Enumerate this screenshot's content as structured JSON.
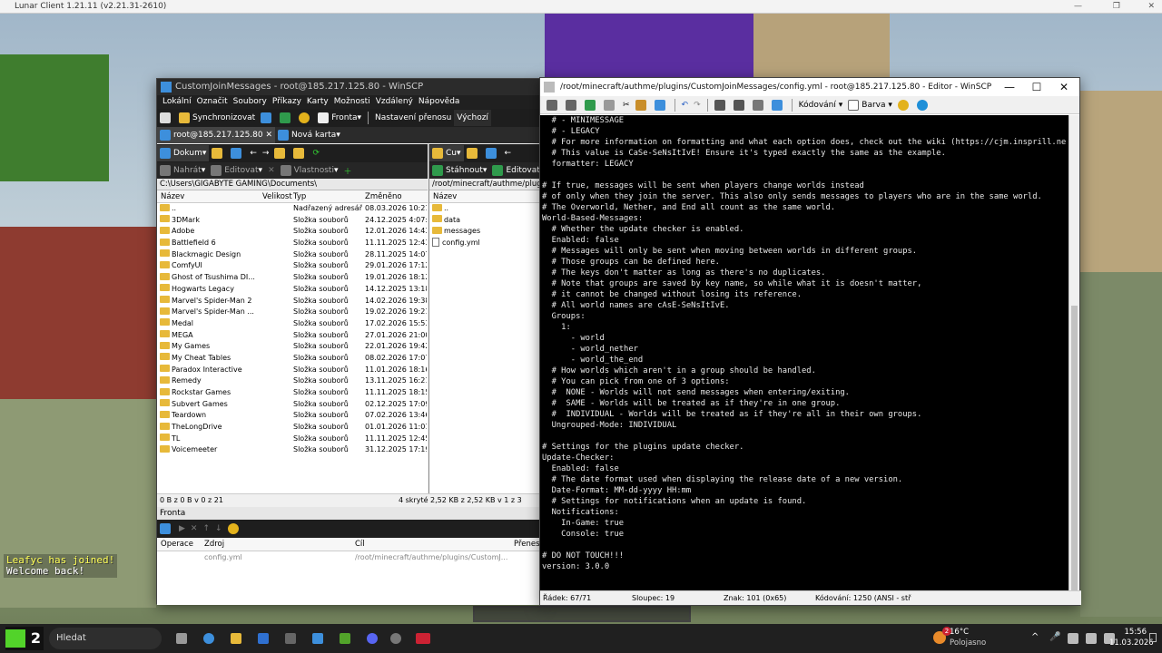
{
  "lunar": {
    "title": "Lunar Client 1.21.11 (v2.21.31-2610)"
  },
  "chat": {
    "player": "Leafyc",
    "joined": " has joined!",
    "welcome": "Welcome back!"
  },
  "winscp": {
    "title": "CustomJoinMessages - root@185.217.125.80 - WinSCP",
    "menu": [
      "Lokální",
      "Označit",
      "Soubory",
      "Příkazy",
      "Karty",
      "Možnosti",
      "Vzdálený",
      "Nápověda"
    ],
    "toolbar": {
      "sync": "Synchronizovat",
      "queue": "Fronta",
      "transfer_settings": "Nastavení přenosu",
      "transfer_value": "Výchozí"
    },
    "tabs": {
      "session": "root@185.217.125.80",
      "new_tab": "Nová karta"
    },
    "left": {
      "drive": "Dokum",
      "actions": {
        "edit_prev": "Nahrát",
        "edit": "Editovat",
        "props": "Vlastnosti"
      },
      "path": "C:\\Users\\GIGABYTE GAMING\\Documents\\",
      "headers": {
        "name": "Název",
        "size": "Velikost",
        "type": "Typ",
        "changed": "Změněno"
      },
      "files": [
        {
          "name": "..",
          "type": "Nadřazený adresář",
          "date": "08.03.2026 10:21:0"
        },
        {
          "name": "3DMark",
          "type": "Složka souborů",
          "date": "24.12.2025 4:07:43"
        },
        {
          "name": "Adobe",
          "type": "Složka souborů",
          "date": "12.01.2026 14:43:1"
        },
        {
          "name": "Battlefield 6",
          "type": "Složka souborů",
          "date": "11.11.2025 12:43:5"
        },
        {
          "name": "Blackmagic Design",
          "type": "Složka souborů",
          "date": "28.11.2025 14:07:2"
        },
        {
          "name": "ComfyUI",
          "type": "Složka souborů",
          "date": "29.01.2026 17:12:1"
        },
        {
          "name": "Ghost of Tsushima DI...",
          "type": "Složka souborů",
          "date": "19.01.2026 18:12:1"
        },
        {
          "name": "Hogwarts Legacy",
          "type": "Složka souborů",
          "date": "14.12.2025 13:18:3"
        },
        {
          "name": "Marvel's Spider-Man 2",
          "type": "Složka souborů",
          "date": "14.02.2026 19:38:1"
        },
        {
          "name": "Marvel's Spider-Man ...",
          "type": "Složka souborů",
          "date": "19.02.2026 19:21:0"
        },
        {
          "name": "Medal",
          "type": "Složka souborů",
          "date": "17.02.2026 15:53:2"
        },
        {
          "name": "MEGA",
          "type": "Složka souborů",
          "date": "27.01.2026 21:00:5"
        },
        {
          "name": "My Games",
          "type": "Složka souborů",
          "date": "22.01.2026 19:42:4"
        },
        {
          "name": "My Cheat Tables",
          "type": "Složka souborů",
          "date": "08.02.2026 17:07:1"
        },
        {
          "name": "Paradox Interactive",
          "type": "Složka souborů",
          "date": "11.01.2026 18:16:4"
        },
        {
          "name": "Remedy",
          "type": "Složka souborů",
          "date": "13.11.2025 16:21:2"
        },
        {
          "name": "Rockstar Games",
          "type": "Složka souborů",
          "date": "11.11.2025 18:15:4"
        },
        {
          "name": "Subvert Games",
          "type": "Složka souborů",
          "date": "02.12.2025 17:09:5"
        },
        {
          "name": "Teardown",
          "type": "Složka souborů",
          "date": "07.02.2026 13:46:2"
        },
        {
          "name": "TheLongDrive",
          "type": "Složka souborů",
          "date": "01.01.2026 11:01:48"
        },
        {
          "name": "TL",
          "type": "Složka souborů",
          "date": "11.11.2025 12:45:5"
        },
        {
          "name": "Voicemeeter",
          "type": "Složka souborů",
          "date": "31.12.2025 17:19:3"
        }
      ],
      "status_left": "0 B z 0 B v 0 z 21",
      "status_right": "4 skryté"
    },
    "right": {
      "drive": "Cu",
      "actions": {
        "download": "Stáhnout",
        "edit": "Editovat"
      },
      "path": "/root/minecraft/authme/plugins/",
      "headers": {
        "name": "Název"
      },
      "files": [
        {
          "name": "..",
          "kind": "up"
        },
        {
          "name": "data",
          "kind": "folder"
        },
        {
          "name": "messages",
          "kind": "folder"
        },
        {
          "name": "config.yml",
          "kind": "file"
        }
      ],
      "status": "2,52 KB z 2,52 KB v 1 z 3"
    },
    "queue": {
      "title": "Fronta",
      "headers": {
        "op": "Operace",
        "source": "Zdroj",
        "target": "Cíl",
        "transferred": "Přenese"
      },
      "item": {
        "source": "config.yml",
        "target": "/root/minecraft/authme/plugins/CustomJ..."
      }
    }
  },
  "editor": {
    "title": "/root/minecraft/authme/plugins/CustomJoinMessages/config.yml - root@185.217.125.80 - Editor - WinSCP",
    "toolbar": {
      "encoding": "Kódování",
      "color": "Barva"
    },
    "lines": [
      "  # - MINIMESSAGE",
      "  # - LEGACY",
      "  # For more information on formatting and what each option does, check out the wiki (https://cjm.insprill.ne",
      "  # This value is CaSe-SeNsItIvE! Ensure it's typed exactly the same as the example.",
      "  formatter: LEGACY",
      "",
      "# If true, messages will be sent when players change worlds instead",
      "# of only when they join the server. This also only sends messages to players who are in the same world.",
      "# The Overworld, Nether, and End all count as the same world.",
      "World-Based-Messages:",
      "  # Whether the update checker is enabled.",
      "  Enabled: false",
      "  # Messages will only be sent when moving between worlds in different groups.",
      "  # Those groups can be defined here.",
      "  # The keys don't matter as long as there's no duplicates.",
      "  # Note that groups are saved by key name, so while what it is doesn't matter,",
      "  # it cannot be changed without losing its reference.",
      "  # All world names are cAsE-SeNsItIvE.",
      "  Groups:",
      "    1:",
      "      - world",
      "      - world_nether",
      "      - world_the_end",
      "  # How worlds which aren't in a group should be handled.",
      "  # You can pick from one of 3 options:",
      "  #  NONE - Worlds will not send messages when entering/exiting.",
      "  #  SAME - Worlds will be treated as if they're in one group.",
      "  #  INDIVIDUAL - Worlds will be treated as if they're all in their own groups.",
      "  Ungrouped-Mode: INDIVIDUAL",
      "",
      "# Settings for the plugins update checker.",
      "Update-Checker:",
      "  Enabled: false",
      "  # The date format used when displaying the release date of a new version.",
      "  Date-Format: MM-dd-yyyy HH:mm",
      "  # Settings for notifications when an update is found.",
      "  Notifications:",
      "    In-Game: true",
      "    Console: true",
      "",
      "# DO NOT TOUCH!!!",
      "version: 3.0.0"
    ],
    "status": {
      "line": "Řádek: 67/71",
      "column": "Sloupec: 19",
      "char": "Znak: 101 (0x65)",
      "encoding": "Kódování: 1250  (ANSI - stř"
    }
  },
  "taskbar": {
    "search": "Hledat",
    "weather_temp": "16°C",
    "weather_text": "Polojasno",
    "time": "15:56",
    "date": "11.03.2026",
    "notif_count": "2",
    "k2": "2"
  },
  "colors": {
    "editor_bg": "#000000",
    "editor_fg": "#e8e8e8",
    "folder": "#e7b93a",
    "taskbar": "#202020",
    "accent": "#0078d4"
  }
}
